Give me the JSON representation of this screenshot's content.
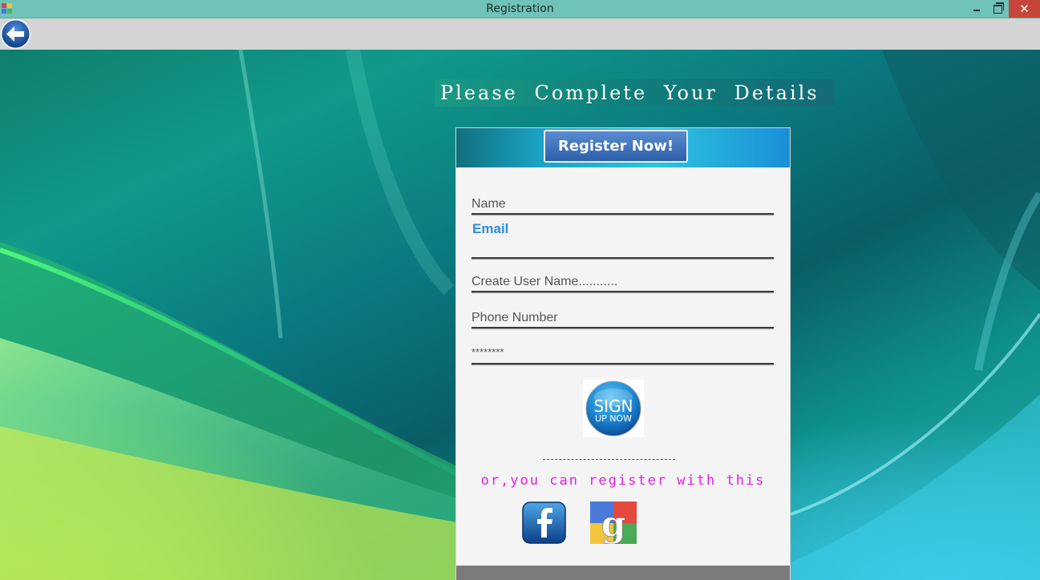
{
  "window": {
    "title": "Registration",
    "close_glyph": "✕"
  },
  "toolbar": {
    "back_icon": "arrow-left-icon"
  },
  "header": {
    "title": "Please Complete Your Details"
  },
  "form": {
    "register_label": "Register Now!",
    "name_placeholder": "Name",
    "email_label": "Email",
    "username_placeholder": "Create User Name...........",
    "phone_placeholder": "Phone Number",
    "password_placeholder": "********",
    "signup_line1": "SIGN",
    "signup_line2": "UP NOW",
    "alt_text": "or,you can register with this",
    "social": [
      "facebook-icon",
      "google-icon"
    ]
  },
  "colors": {
    "title_bar": "#6fc3b8",
    "close_button": "#c7463b",
    "email_label": "#2e8de0",
    "alt_text": "#e21ee6"
  }
}
